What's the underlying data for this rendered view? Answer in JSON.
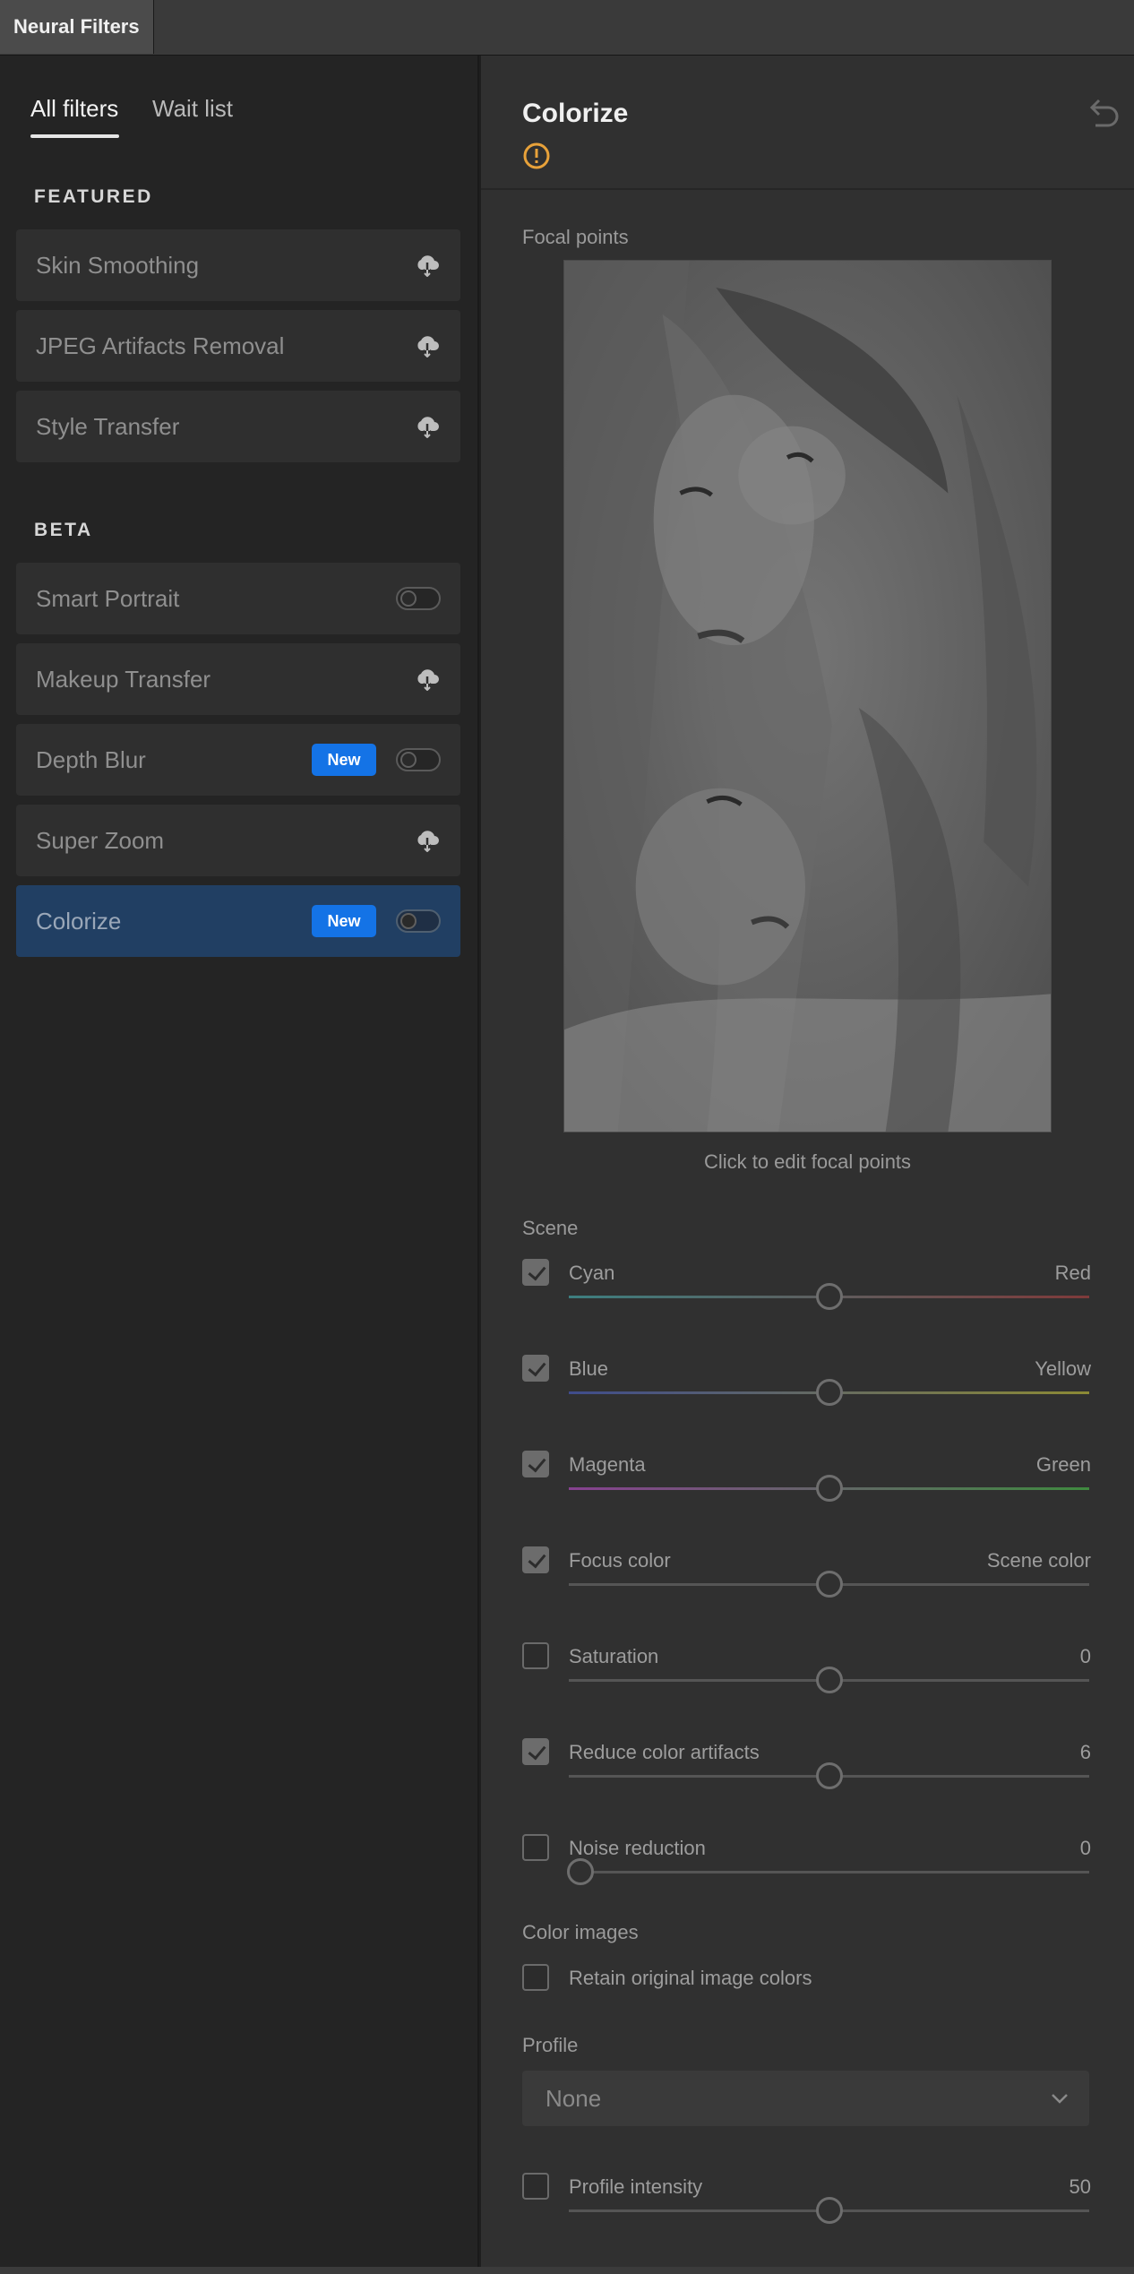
{
  "window": {
    "tab_label": "Neural Filters"
  },
  "left_panel": {
    "tabs": [
      {
        "label": "All filters",
        "active": true
      },
      {
        "label": "Wait list",
        "active": false
      }
    ],
    "featured_label": "FEATURED",
    "featured": [
      {
        "name": "Skin Smoothing",
        "control": "cloud-download-icon"
      },
      {
        "name": "JPEG Artifacts Removal",
        "control": "cloud-download-icon"
      },
      {
        "name": "Style Transfer",
        "control": "cloud-download-icon"
      }
    ],
    "beta_label": "BETA",
    "beta": [
      {
        "name": "Smart Portrait",
        "control": "toggle",
        "on": false
      },
      {
        "name": "Makeup Transfer",
        "control": "cloud-download-icon"
      },
      {
        "name": "Depth Blur",
        "badge": "New",
        "control": "toggle",
        "on": false
      },
      {
        "name": "Super Zoom",
        "control": "cloud-download-icon"
      },
      {
        "name": "Colorize",
        "badge": "New",
        "control": "toggle",
        "on": false,
        "selected": true
      }
    ]
  },
  "right_panel": {
    "title": "Colorize",
    "warning_icon": "alert-circle-icon",
    "reset_icon": "undo-icon",
    "focal_label": "Focal points",
    "photo_note": "Click to edit focal points",
    "scene_label": "Scene",
    "sliders": [
      {
        "label": "Cyan",
        "right": "Red",
        "checked": true,
        "value": 0.5,
        "gradient": [
          "#3d7f80",
          "#7f3a3a"
        ]
      },
      {
        "label": "Blue",
        "right": "Yellow",
        "checked": true,
        "value": 0.5,
        "gradient": [
          "#3f4c8c",
          "#8c8a35"
        ]
      },
      {
        "label": "Magenta",
        "right": "Green",
        "checked": true,
        "value": 0.5,
        "gradient": [
          "#874190",
          "#3f8a3f"
        ]
      },
      {
        "label": "Focus color",
        "right": "Scene color",
        "checked": true,
        "value": 0.5
      },
      {
        "label": "Saturation",
        "right": "0",
        "checked": false,
        "value": 0.5
      },
      {
        "label": "Reduce color artifacts",
        "right": "6",
        "checked": true,
        "value": 0.5
      },
      {
        "label": "Noise reduction",
        "right": "0",
        "checked": false,
        "value": 0.0
      }
    ],
    "color_images_label": "Color images",
    "retain_label": "Retain original image colors",
    "retain_checked": false,
    "profile_label": "Profile",
    "profile_value": "None",
    "profile_intensity": {
      "label": "Profile intensity",
      "right": "50",
      "checked": false,
      "value": 0.5
    }
  }
}
